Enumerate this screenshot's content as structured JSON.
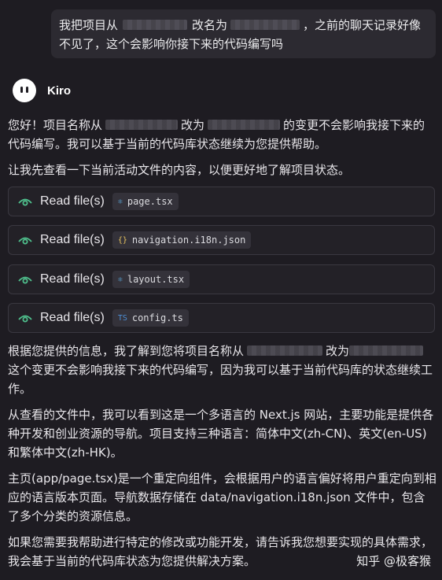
{
  "user_message": {
    "part1": "我把项目从",
    "part2": "改名为",
    "part3": "，之前的聊天记录好像不见了，这个会影响你接下来的代码编写吗"
  },
  "assistant": {
    "name": "Kiro",
    "reply1_a": "您好！项目名称从",
    "reply1_b": "改为",
    "reply1_c": "的变更不会影响我接下来的代码编写。我可以基于当前的代码库状态继续为您提供帮助。",
    "reply2": "让我先查看一下当前活动文件的内容，以便更好地了解项目状态。",
    "tool_calls": [
      {
        "label": "Read file(s)",
        "file": "page.tsx",
        "icon": "react-icon",
        "glyph": "⚛",
        "color": "#5fb3e8"
      },
      {
        "label": "Read file(s)",
        "file": "navigation.i18n.json",
        "icon": "json-icon",
        "glyph": "{}",
        "color": "#e8c45f"
      },
      {
        "label": "Read file(s)",
        "file": "layout.tsx",
        "icon": "react-icon",
        "glyph": "⚛",
        "color": "#5fb3e8"
      },
      {
        "label": "Read file(s)",
        "file": "config.ts",
        "icon": "typescript-icon",
        "glyph": "TS",
        "color": "#4d8fd6"
      }
    ],
    "reply3_a": "根据您提供的信息，我了解到您将项目名称从",
    "reply3_b": "改为",
    "reply3_c": "这个变更不会影响我接下来的代码编写，因为我可以基于当前代码库的状态继续工作。",
    "reply4": "从查看的文件中，我可以看到这是一个多语言的 Next.js 网站，主要功能是提供各种开发和创业资源的导航。项目支持三种语言：简体中文(zh-CN)、英文(en-US)和繁体中文(zh-HK)。",
    "reply5": "主页(app/page.tsx)是一个重定向组件，会根据用户的语言偏好将用户重定向到相应的语言版本页面。导航数据存储在 data/navigation.i18n.json 文件中，包含了多个分类的资源信息。",
    "reply6": "如果您需要我帮助进行特定的修改或功能开发，请告诉我您想要实现的具体需求，我会基于当前的代码库状态为您提供解决方案。"
  },
  "watermark": "知乎 @极客猴",
  "colors": {
    "background": "#1e1c22",
    "accent_eye": "#4fc08d"
  }
}
